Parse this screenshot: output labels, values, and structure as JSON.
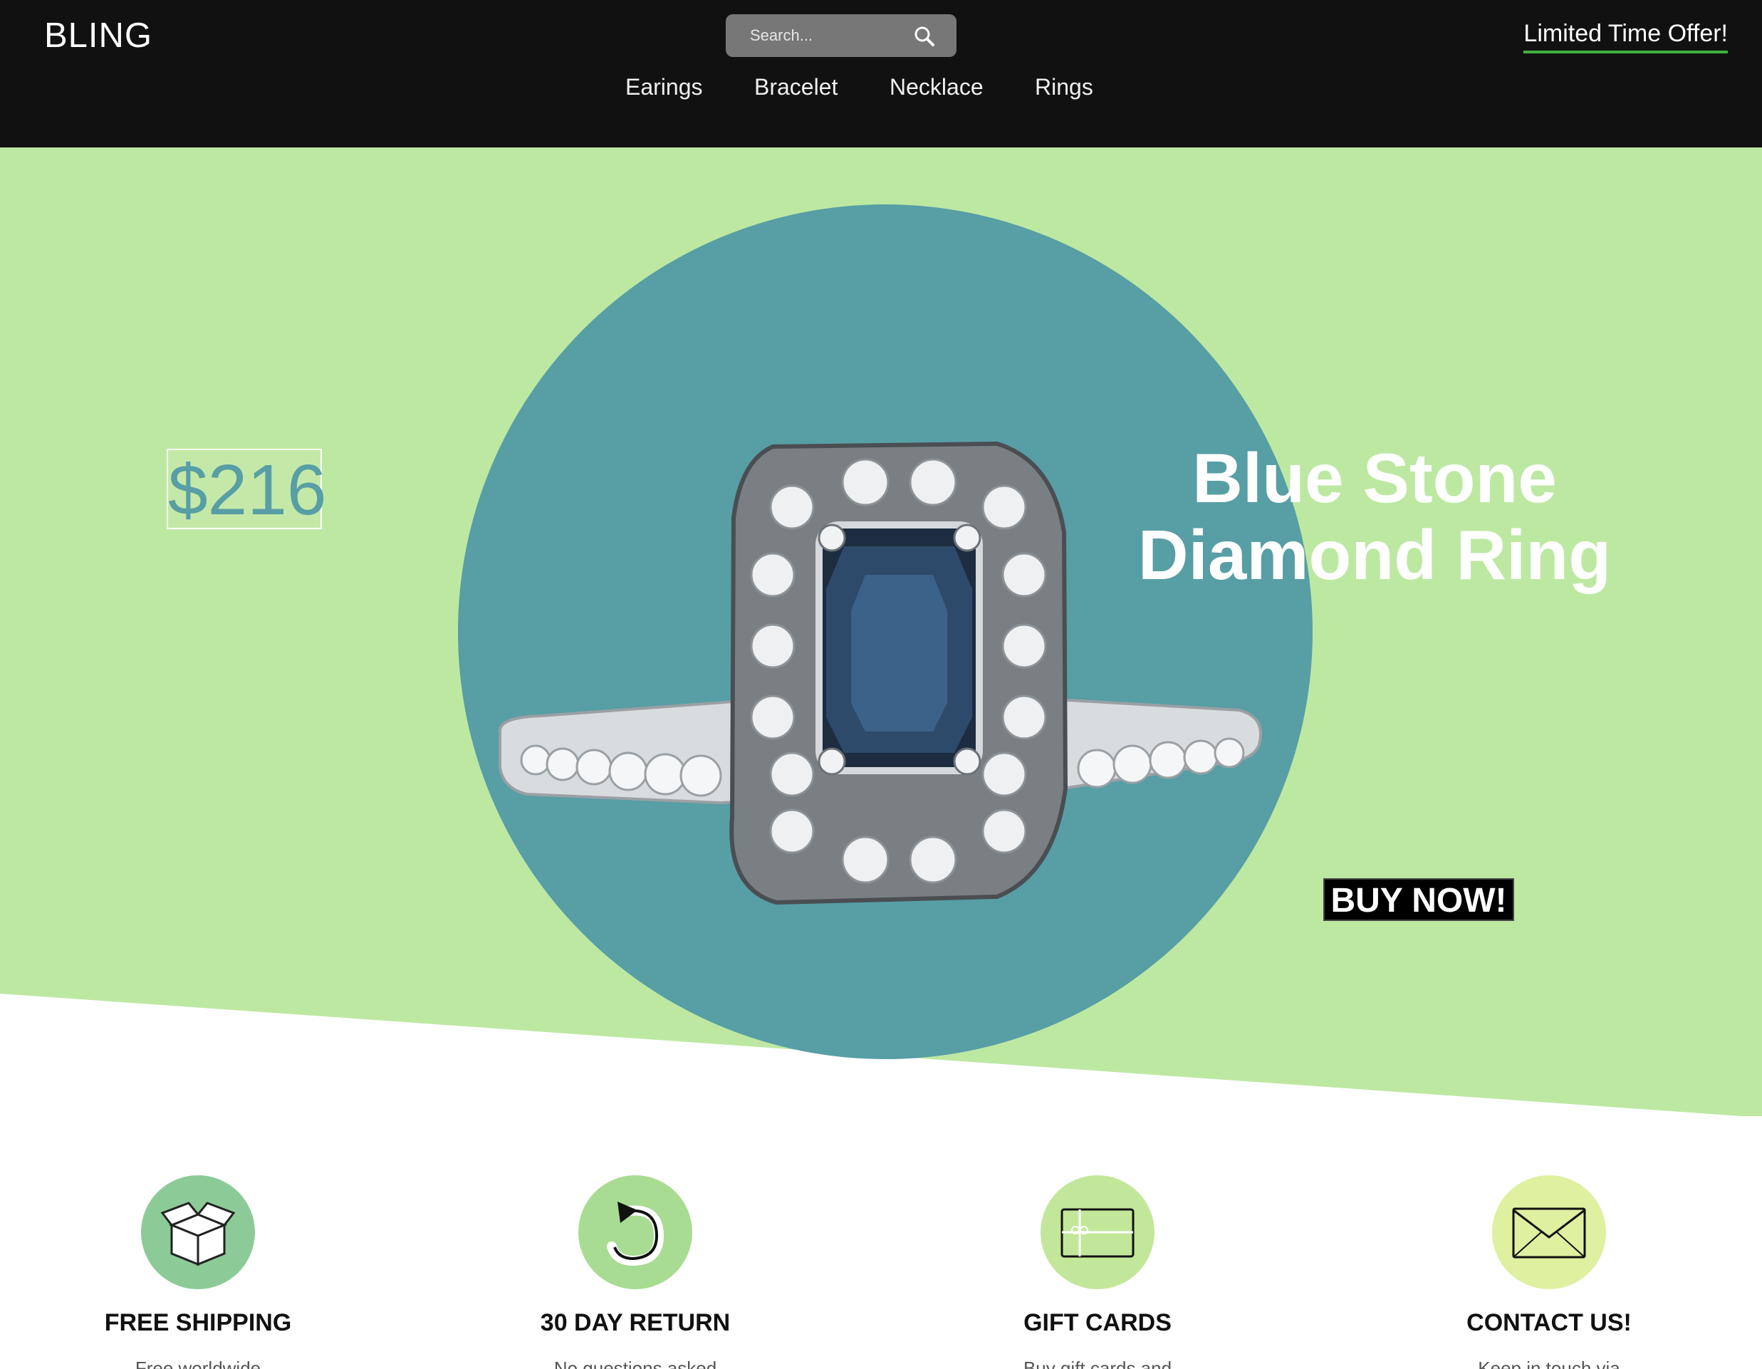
{
  "header": {
    "brand": "BLING",
    "search_placeholder": "Search...",
    "nav": [
      "Earings",
      "Bracelet",
      "Necklace",
      "Rings"
    ],
    "offer": "Limited Time Offer!"
  },
  "hero": {
    "price": "$216",
    "title_line1": "Blue Stone",
    "title_line2": "Diamond Ring",
    "buy_label": "BUY NOW!"
  },
  "features": [
    {
      "title": "FREE SHIPPING",
      "sub": "Free worldwide",
      "icon": "box-icon"
    },
    {
      "title": "30 DAY RETURN",
      "sub": "No questions asked",
      "icon": "return-arrow-icon"
    },
    {
      "title": "GIFT CARDS",
      "sub": "Buy gift cards and",
      "icon": "gift-card-icon"
    },
    {
      "title": "CONTACT US!",
      "sub": "Keep in touch via",
      "icon": "envelope-icon"
    }
  ],
  "colors": {
    "header_bg": "#111111",
    "hero_green": "#bde8a2",
    "circle_teal": "#579ea5",
    "offer_underline": "#3fb33f",
    "feature_circles": [
      "#8ccb97",
      "#a8dc92",
      "#c2e79a",
      "#dff0a0"
    ]
  }
}
